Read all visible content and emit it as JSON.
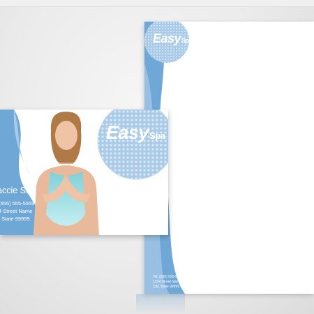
{
  "brand": {
    "name": "Easy",
    "suffix": "Spa"
  },
  "card": {
    "name": "accie Sun",
    "phone": "(555) 555-5555",
    "street": "4 Street Name",
    "city": ", State 99999"
  },
  "letterhead": {
    "phone": "Tel: (555) 555-5555",
    "street": "1234 Street Name",
    "city": "City, State 99999"
  },
  "colors": {
    "accent": "#6fa8d6",
    "accent_light": "#a9cbe8",
    "dot": "#c9dbee"
  }
}
